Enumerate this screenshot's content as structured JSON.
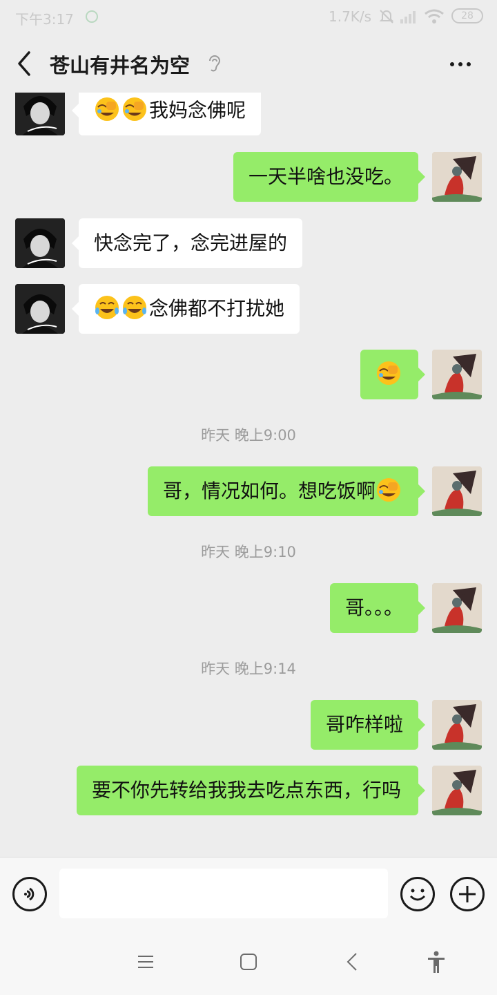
{
  "status_bar": {
    "time": "下午3:17",
    "network_speed": "1.7K/s",
    "battery": "28"
  },
  "header": {
    "title": "苍山有井名为空"
  },
  "messages": [
    {
      "side": "left",
      "text": "我妈念佛呢",
      "emojis": [
        "facepalm-laugh",
        "facepalm-laugh"
      ]
    },
    {
      "side": "right",
      "text": "一天半啥也没吃。"
    },
    {
      "side": "left",
      "text": "快念完了，念完进屋的"
    },
    {
      "side": "left",
      "text": "念佛都不打扰她",
      "emojis": [
        "tears-of-joy",
        "tears-of-joy"
      ]
    },
    {
      "side": "right",
      "text": "",
      "emojis": [
        "facepalm-laugh"
      ]
    },
    {
      "timestamp": "昨天 晚上9:00"
    },
    {
      "side": "right",
      "text": "哥，情况如何。想吃饭啊",
      "trailing_emoji": "facepalm-laugh"
    },
    {
      "timestamp": "昨天 晚上9:10"
    },
    {
      "side": "right",
      "text": "哥。。。"
    },
    {
      "timestamp": "昨天 晚上9:14"
    },
    {
      "side": "right",
      "text": "哥咋样啦"
    },
    {
      "side": "right",
      "text": "要不你先转给我我去吃点东西，行吗"
    }
  ],
  "input": {
    "placeholder": ""
  },
  "colors": {
    "background": "#ededed",
    "sent_bubble": "#95ec69",
    "received_bubble": "#ffffff"
  },
  "icons": {
    "back": "chevron-left-icon",
    "ear": "ear-icon",
    "more": "more-icon",
    "voice": "voice-icon",
    "emoji": "smile-icon",
    "add": "plus-icon"
  }
}
